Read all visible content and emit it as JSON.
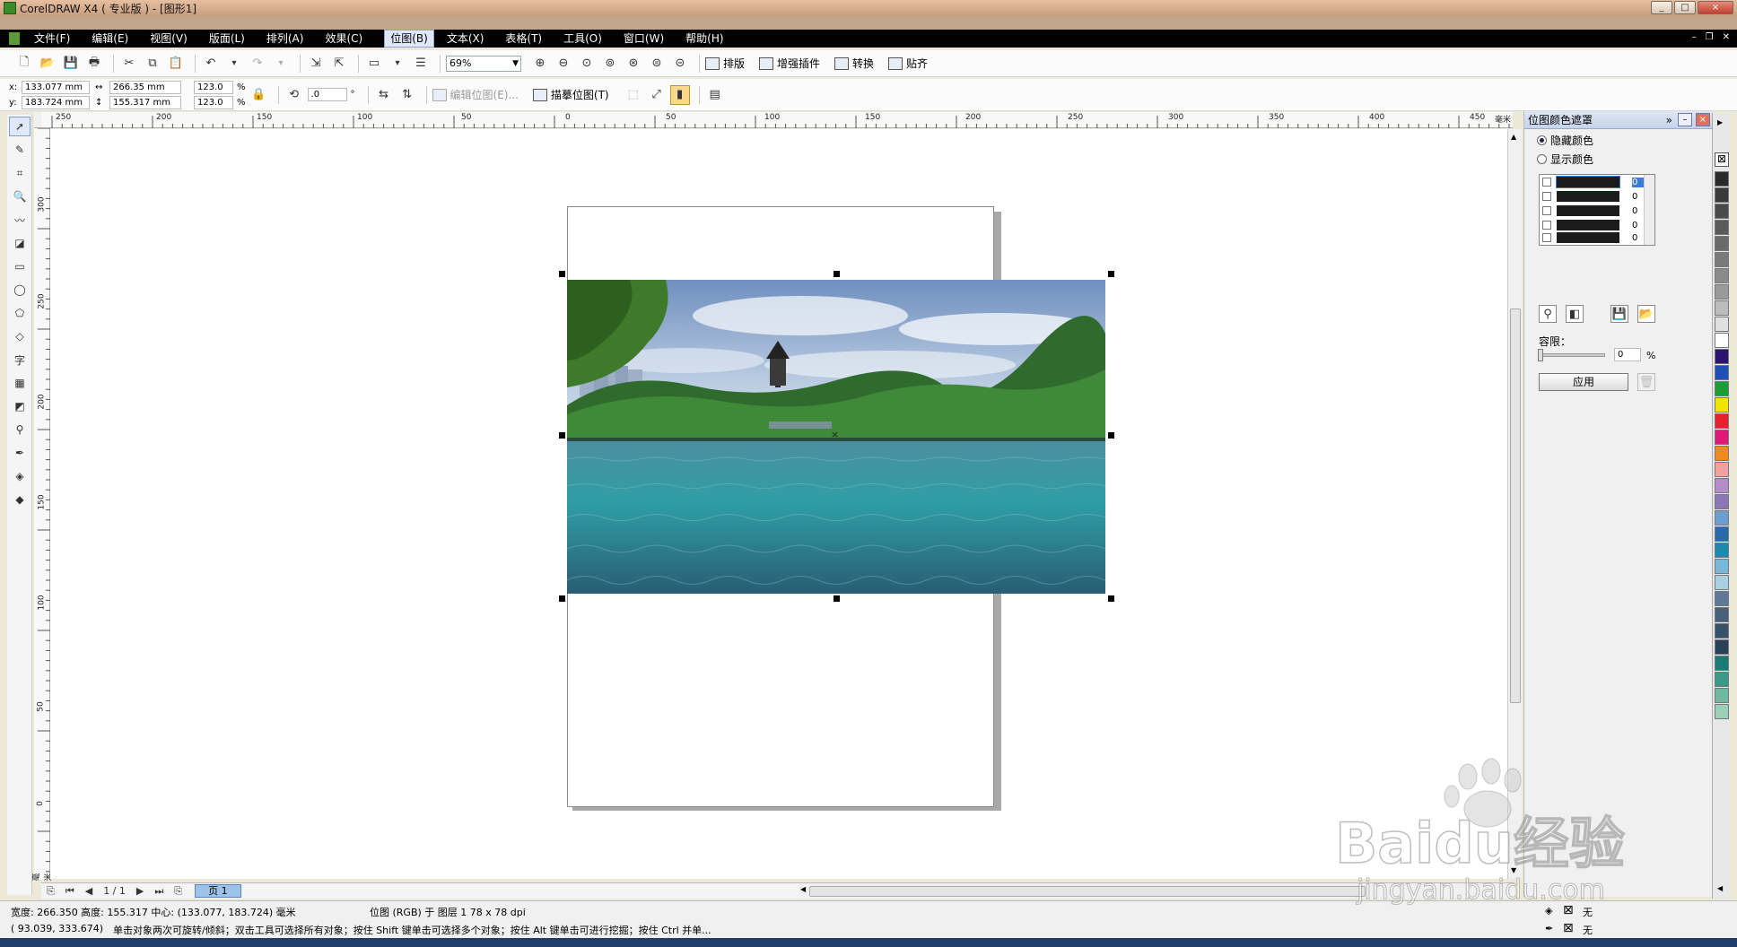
{
  "window": {
    "title": "CorelDRAW X4 ( 专业版 ) - [图形1]",
    "controls": [
      "_",
      "□",
      "×"
    ]
  },
  "menu": [
    {
      "label": "文件(F)"
    },
    {
      "label": "编辑(E)"
    },
    {
      "label": "视图(V)"
    },
    {
      "label": "版面(L)"
    },
    {
      "label": "排列(A)"
    },
    {
      "label": "效果(C)"
    },
    {
      "label": "位图(B)"
    },
    {
      "label": "文本(X)"
    },
    {
      "label": "表格(T)"
    },
    {
      "label": "工具(O)"
    },
    {
      "label": "窗口(W)"
    },
    {
      "label": "帮助(H)"
    }
  ],
  "toolbar": {
    "zoom": "69%",
    "buttons": {
      "layout": "排版",
      "plugins": "增强插件",
      "convert": "转换",
      "snap": "贴齐"
    }
  },
  "property_bar": {
    "x": "133.077 mm",
    "y": "183.724 mm",
    "width": "266.35 mm",
    "height": "155.317 mm",
    "scale_x": "123.0",
    "scale_y": "123.0",
    "percent": "%",
    "rotation": ".0",
    "degree": "°",
    "edit_bitmap": "编辑位图(E)...",
    "trace_bitmap": "描摹位图(T)"
  },
  "rulers": {
    "top": [
      "250",
      "200",
      "150",
      "100",
      "50",
      "0",
      "50",
      "100",
      "150",
      "200",
      "250",
      "300",
      "350",
      "400",
      "450"
    ],
    "top_unit": "毫米",
    "left": [
      "300",
      "250",
      "200",
      "150",
      "100",
      "50",
      "0"
    ],
    "left_unit": "毫米"
  },
  "docker": {
    "title": "位图颜色遮罩",
    "option_hide": "隐藏颜色",
    "option_show": "显示颜色",
    "colors": [
      {
        "value": "0",
        "selected": true
      },
      {
        "value": "0",
        "selected": false
      },
      {
        "value": "0",
        "selected": false
      },
      {
        "value": "0",
        "selected": false
      },
      {
        "value": "0",
        "selected": false
      }
    ],
    "tolerance_label": "容限：",
    "tolerance_value": "0",
    "tolerance_unit": "%",
    "apply": "应用"
  },
  "palette": [
    "#2a2a2a",
    "#3a3a3a",
    "#4a4a4a",
    "#5a5a5a",
    "#6a6a6a",
    "#7a7a7a",
    "#8a8a8a",
    "#9a9a9a",
    "#bcbcbc",
    "#e0e0e0",
    "#ffffff",
    "#2b1470",
    "#1f4fb5",
    "#19a035",
    "#f2e400",
    "#e8212f",
    "#e0187a",
    "#f08a1e",
    "#f4a0a0",
    "#b48cc8",
    "#8a78b6",
    "#6e9ed0",
    "#2a6aa8",
    "#1c8ab0",
    "#7ab8d8",
    "#a8d0e0",
    "#5e7896",
    "#48607a",
    "#385068",
    "#284058",
    "#1a7a74",
    "#3a9a8a",
    "#70b8a0",
    "#9ad0b8"
  ],
  "page_nav": {
    "counter": "1 / 1",
    "tab": "页 1"
  },
  "status": {
    "line1_dims": "宽度: 266.350  高度: 155.317  中心: (133.077, 183.724)  毫米",
    "line1_obj": "位图 (RGB) 于 图层 1 78 x 78 dpi",
    "line2_coords": "( 93.039, 333.674)",
    "line2_hint": "单击对象两次可旋转/倾斜；双击工具可选择所有对象；按住 Shift 键单击可选择多个对象；按住 Alt 键单击可进行挖掘；按住 Ctrl 并单...",
    "fill": "无",
    "outline": "无"
  },
  "watermark": {
    "brand": "Baidu经验",
    "url": "jingyan.baidu.com"
  }
}
